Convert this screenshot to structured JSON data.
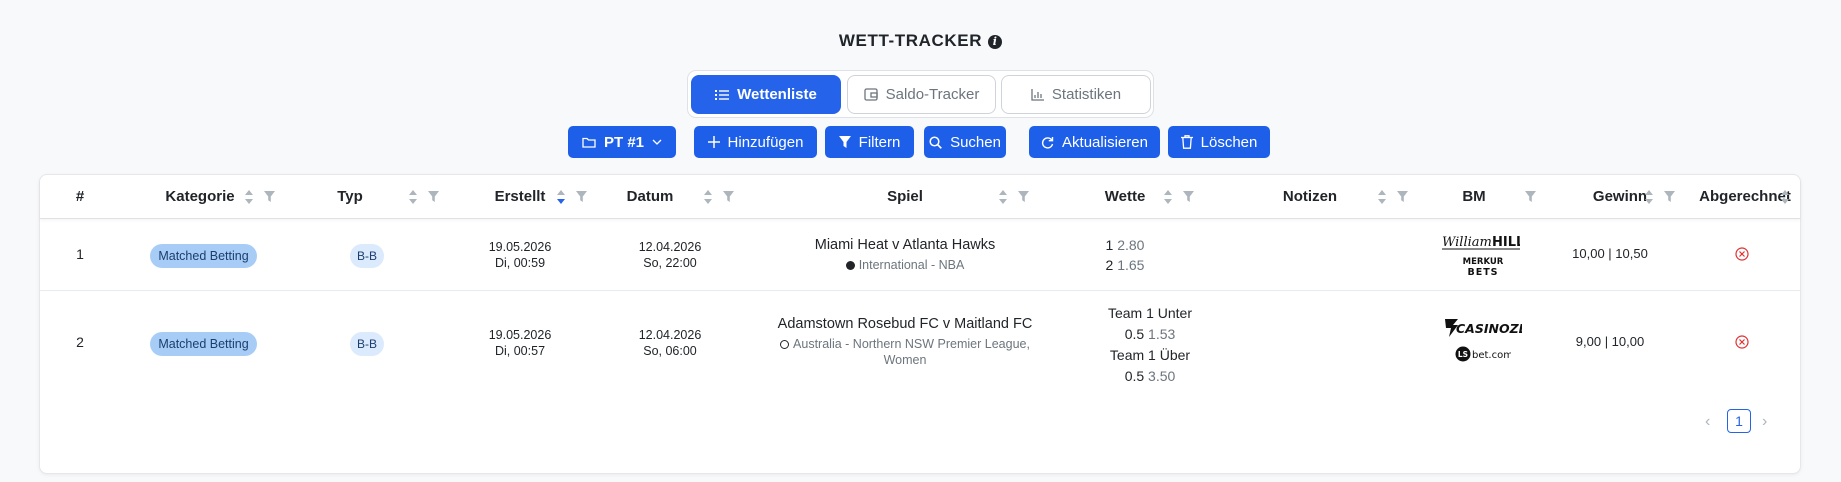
{
  "header": {
    "title": "WETT-TRACKER",
    "info_icon": "info-icon"
  },
  "tabs": [
    {
      "label": "Wettenliste",
      "icon": "list-icon",
      "active": true
    },
    {
      "label": "Saldo-Tracker",
      "icon": "wallet-icon",
      "active": false
    },
    {
      "label": "Statistiken",
      "icon": "bar-chart-icon",
      "active": false
    }
  ],
  "toolbar": {
    "profile": "PT #1",
    "add": "Hinzufügen",
    "filter": "Filtern",
    "search": "Suchen",
    "refresh": "Aktualisieren",
    "delete": "Löschen"
  },
  "table": {
    "columns": [
      "#",
      "Kategorie",
      "Typ",
      "Erstellt",
      "Datum",
      "Spiel",
      "Wette",
      "Notizen",
      "BM",
      "Gewinn",
      "Abgerechnet"
    ],
    "rows": [
      {
        "num": "1",
        "kategorie": "Matched Betting",
        "typ": "B-B",
        "erstellt_date": "19.05.2026",
        "erstellt_time": "Di, 00:59",
        "datum_date": "12.04.2026",
        "datum_time": "So, 22:00",
        "spiel": "Miami Heat v Atlanta Hawks",
        "liga": "International - NBA",
        "wette": [
          {
            "label": "1",
            "odds": "2.80"
          },
          {
            "label": "2",
            "odds": "1.65"
          }
        ],
        "bm": [
          "William Hill",
          "Merkur Bets"
        ],
        "gewinn": "10,00 | 10,50"
      },
      {
        "num": "2",
        "kategorie": "Matched Betting",
        "typ": "B-B",
        "erstellt_date": "19.05.2026",
        "erstellt_time": "Di, 00:57",
        "datum_date": "12.04.2026",
        "datum_time": "So, 06:00",
        "spiel": "Adamstown Rosebud FC v Maitland FC",
        "liga_line1": "Australia - Northern NSW Premier League,",
        "liga_line2": "Women",
        "wette": [
          {
            "label": "Team 1 Unter",
            "line": "0.5",
            "odds": "1.53"
          },
          {
            "label": "Team 1 Über",
            "line": "0.5",
            "odds": "3.50"
          }
        ],
        "bm": [
          "Casinozer",
          "LSbet.com"
        ],
        "gewinn": "9,00 | 10,00"
      }
    ]
  },
  "pagination": {
    "current": "1",
    "prev": "‹",
    "next": "›"
  },
  "colors": {
    "accent": "#2563eb",
    "danger": "#e03131",
    "badge_cat": "#a7cdf7",
    "badge_typ": "#dbeafc"
  }
}
